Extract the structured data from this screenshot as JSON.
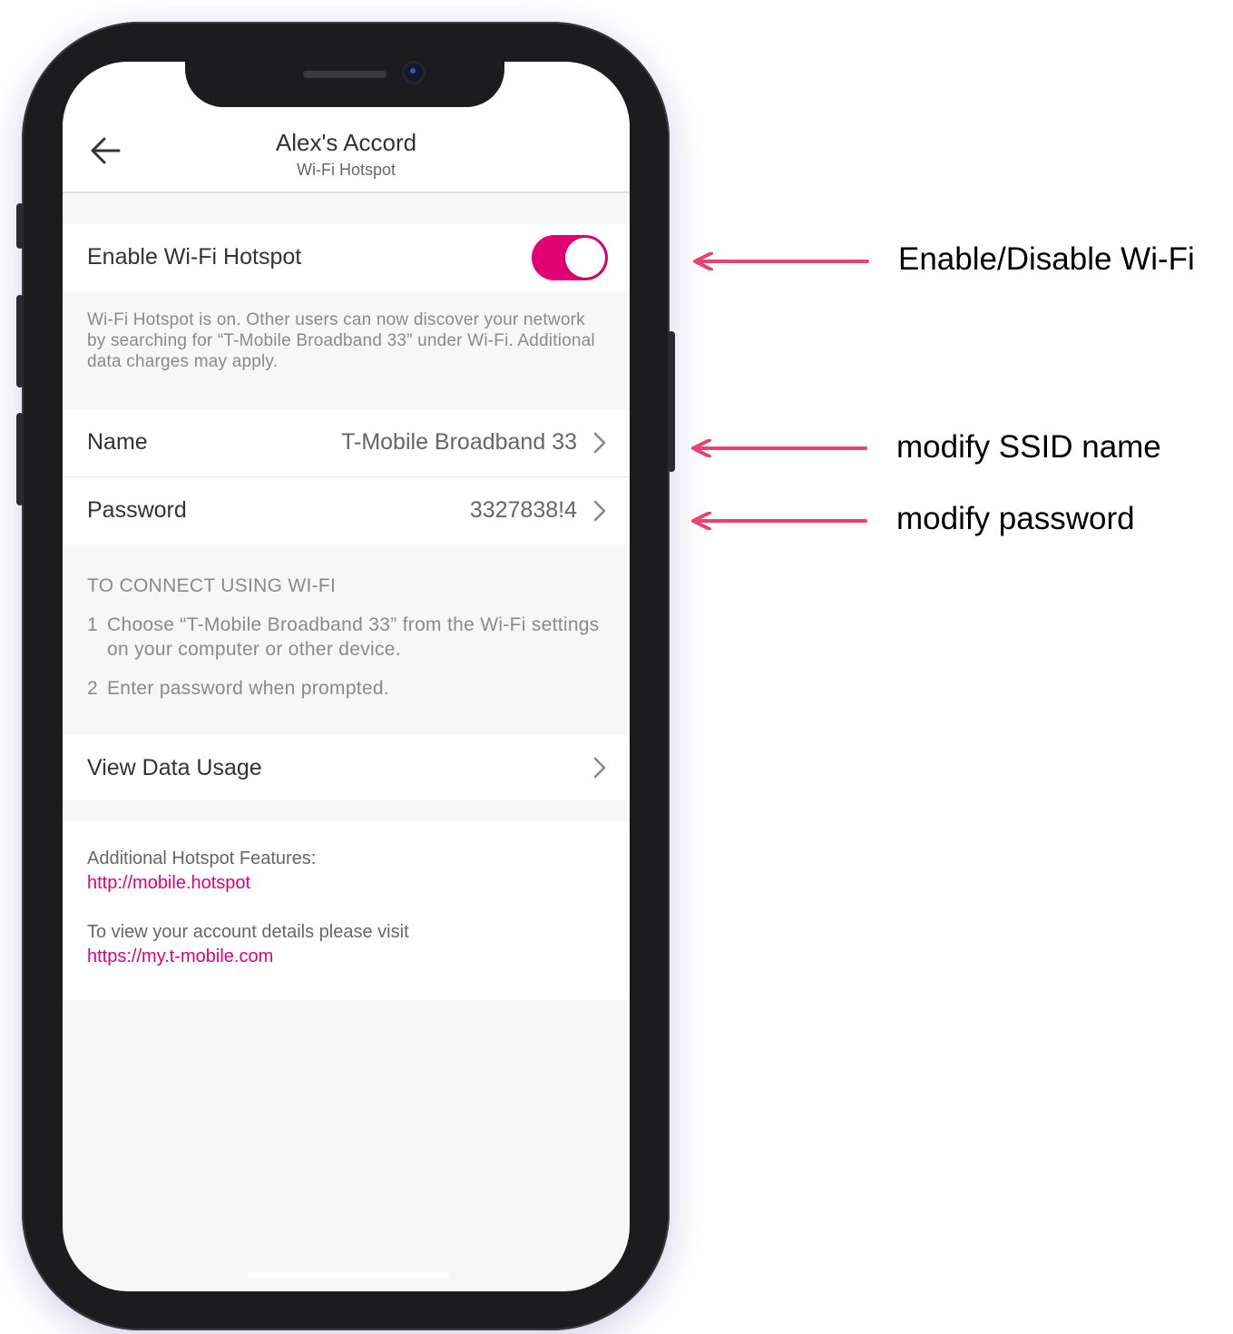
{
  "header": {
    "title": "Alex's Accord",
    "subtitle": "Wi-Fi Hotspot",
    "back_icon": "arrow-left-icon"
  },
  "hotspot": {
    "enable_label": "Enable Wi-Fi Hotspot",
    "enabled": true,
    "description": "Wi-Fi Hotspot is on. Other users can now discover your network by searching for “T-Mobile Broadband 33” under Wi-Fi. Additional data charges may apply."
  },
  "settings": {
    "name_label": "Name",
    "name_value": "T-Mobile Broadband 33",
    "password_label": "Password",
    "password_value": "3327838!4"
  },
  "connect": {
    "heading": "TO CONNECT USING WI-FI",
    "steps": [
      {
        "num": "1",
        "text": "Choose “T-Mobile Broadband 33” from the Wi-Fi settings on your computer or other device."
      },
      {
        "num": "2",
        "text": "Enter password when prompted."
      }
    ]
  },
  "data_usage": {
    "label": "View Data Usage"
  },
  "info": {
    "features_label": "Additional Hotspot Features:",
    "features_link": "http://mobile.hotspot",
    "account_label": "To view your account details please visit",
    "account_link": "https://my.t-mobile.com"
  },
  "annotations": {
    "enable": "Enable/Disable Wi-Fi",
    "ssid": "modify SSID name",
    "password": "modify password"
  },
  "colors": {
    "accent": "#e20074",
    "annotation_arrow": "#e8436e"
  }
}
